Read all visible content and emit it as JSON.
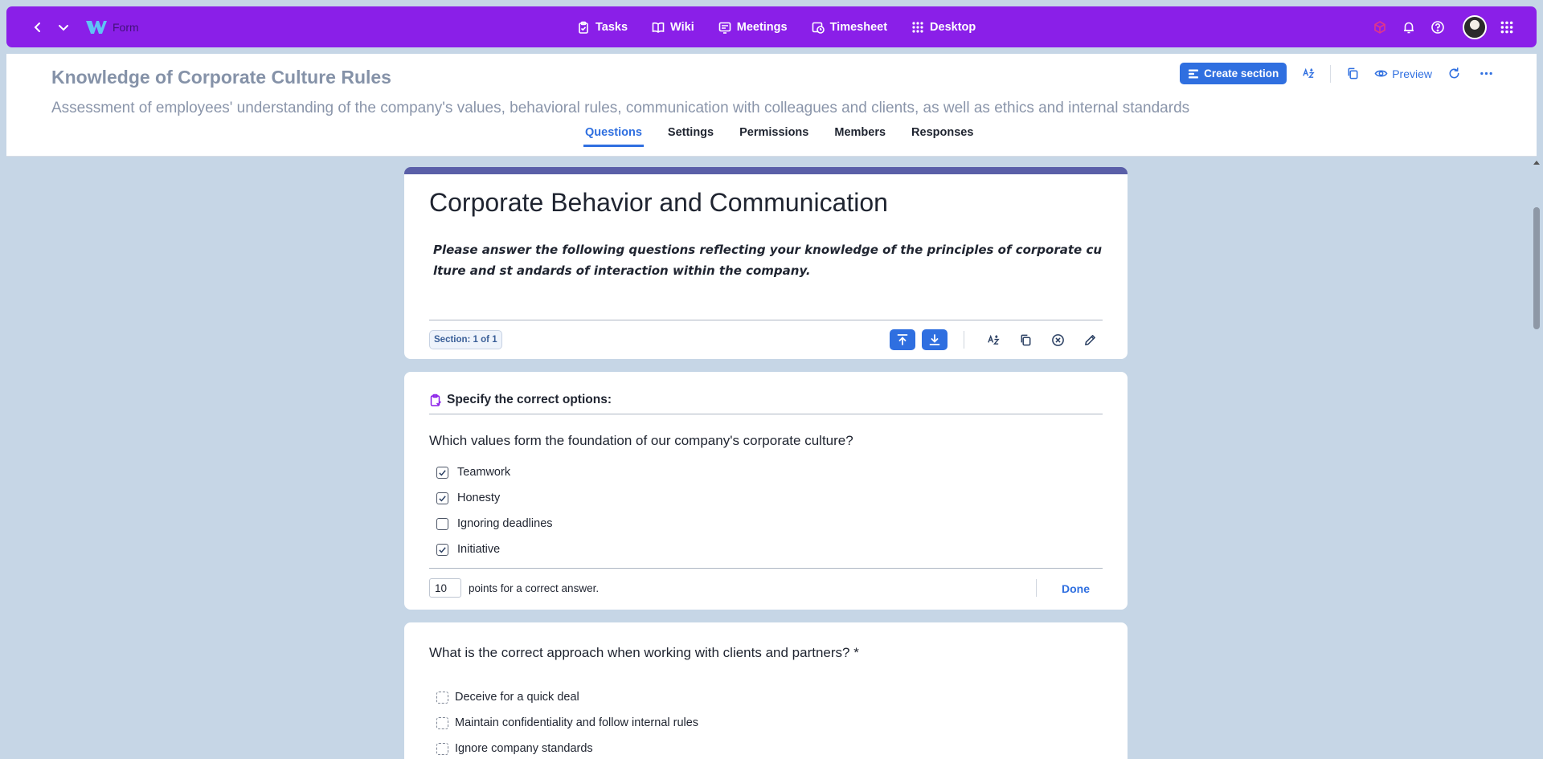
{
  "topbar": {
    "app_name": "Form",
    "nav": [
      {
        "label": "Tasks",
        "icon": "clipboard-icon"
      },
      {
        "label": "Wiki",
        "icon": "book-icon"
      },
      {
        "label": "Meetings",
        "icon": "meetings-icon"
      },
      {
        "label": "Timesheet",
        "icon": "timesheet-icon"
      },
      {
        "label": "Desktop",
        "icon": "grid-icon"
      }
    ]
  },
  "header": {
    "title": "Knowledge of Corporate Culture Rules",
    "description": "Assessment of employees' understanding of the company's values, behavioral rules, communication with colleagues and clients, as well as ethics and internal standards",
    "create_section_label": "Create section",
    "preview_label": "Preview",
    "tabs": [
      {
        "label": "Questions",
        "active": true
      },
      {
        "label": "Settings",
        "active": false
      },
      {
        "label": "Permissions",
        "active": false
      },
      {
        "label": "Members",
        "active": false
      },
      {
        "label": "Responses",
        "active": false
      }
    ]
  },
  "section": {
    "title": "Corporate Behavior and Communication",
    "description": "Please answer the following questions reflecting your knowledge of the principles of corporate culture and st andards of interaction within the company.",
    "badge": "Section: 1 of 1"
  },
  "question1": {
    "heading": "Specify the correct options:",
    "text": "Which values form the foundation of our company's corporate culture?",
    "options": [
      {
        "label": "Teamwork",
        "checked": true
      },
      {
        "label": "Honesty",
        "checked": true
      },
      {
        "label": "Ignoring deadlines",
        "checked": false
      },
      {
        "label": "Initiative",
        "checked": true
      }
    ],
    "points_value": "10",
    "points_label": "points for a correct answer.",
    "done_label": "Done"
  },
  "question2": {
    "text": "What is the correct approach when working with clients and partners? *",
    "options": [
      {
        "label": "Deceive for a quick deal"
      },
      {
        "label": "Maintain confidentiality and follow internal rules"
      },
      {
        "label": "Ignore company standards"
      }
    ]
  },
  "colors": {
    "topbar": "#8a1fe8",
    "accent": "#2f6fe0",
    "section_bar": "#5a5fa8",
    "background": "#c6d6e6"
  }
}
